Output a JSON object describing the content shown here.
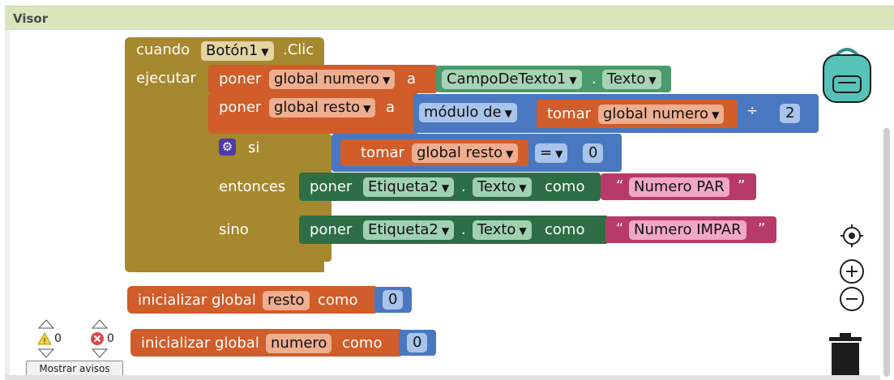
{
  "header": {
    "title": "Visor"
  },
  "event": {
    "cuando": "cuando",
    "component": "Botón1",
    "event": ".Clic",
    "ejecutar": "ejecutar"
  },
  "set1": {
    "poner": "poner",
    "var": "global numero",
    "a": "a",
    "component": "CampoDeTexto1",
    "dot": ".",
    "prop": "Texto"
  },
  "set2": {
    "poner": "poner",
    "var": "global resto",
    "a": "a",
    "op": "módulo de",
    "tomar": "tomar",
    "getvar": "global numero",
    "div": "÷",
    "num": "2"
  },
  "ifblock": {
    "si": "si",
    "entonces": "entonces",
    "sino": "sino",
    "tomar": "tomar",
    "getvar": "global resto",
    "eq": "=",
    "num": "0"
  },
  "then_set": {
    "poner": "poner",
    "component": "Etiqueta2",
    "dot": ".",
    "prop": "Texto",
    "como": "como",
    "text": "Numero PAR"
  },
  "else_set": {
    "poner": "poner",
    "component": "Etiqueta2",
    "dot": ".",
    "prop": "Texto",
    "como": "como",
    "text": "Numero IMPAR"
  },
  "init1": {
    "label": "inicializar global",
    "name": "resto",
    "como": "como",
    "value": "0"
  },
  "init2": {
    "label": "inicializar global",
    "name": "numero",
    "como": "como",
    "value": "0"
  },
  "warnings": {
    "warn_count": "0",
    "error_count": "0",
    "button": "Mostrar avisos"
  },
  "quote_open": "“",
  "quote_close": "”",
  "colors": {
    "event": "#a6882f",
    "variable": "#d05d2a",
    "component": "#4a9a6b",
    "setter": "#2e6e46",
    "math": "#4978c0",
    "text": "#b83a6a",
    "control": "#a6882f"
  }
}
